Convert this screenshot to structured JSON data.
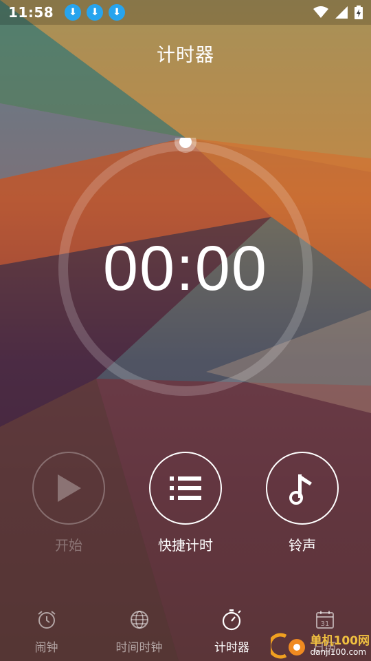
{
  "status_bar": {
    "time": "11:58",
    "download_icons": [
      "download-icon",
      "download-icon",
      "download-icon"
    ],
    "icons": [
      "wifi-icon",
      "signal-icon",
      "battery-charging-icon"
    ]
  },
  "header": {
    "title": "计时器"
  },
  "timer": {
    "display": "00:00",
    "progress": 0
  },
  "actions": {
    "start": {
      "label": "开始",
      "icon": "play-icon",
      "enabled": false
    },
    "quick": {
      "label": "快捷计时",
      "icon": "list-icon"
    },
    "ringtone": {
      "label": "铃声",
      "icon": "music-note-icon"
    }
  },
  "nav": {
    "items": [
      {
        "label": "闹钟",
        "icon": "alarm-clock-icon",
        "active": false
      },
      {
        "label": "时间时钟",
        "icon": "globe-icon",
        "active": false
      },
      {
        "label": "计时器",
        "icon": "stopwatch-icon",
        "active": true
      },
      {
        "label": "日历",
        "icon": "calendar-icon",
        "active": false,
        "icon_text": "31"
      }
    ]
  },
  "watermark": {
    "main": "单机100网",
    "sub": "danji100.com"
  },
  "colors": {
    "download_badge": "#27a4ee",
    "watermark_gold": "#f0c040",
    "accent": "#ffffff"
  }
}
